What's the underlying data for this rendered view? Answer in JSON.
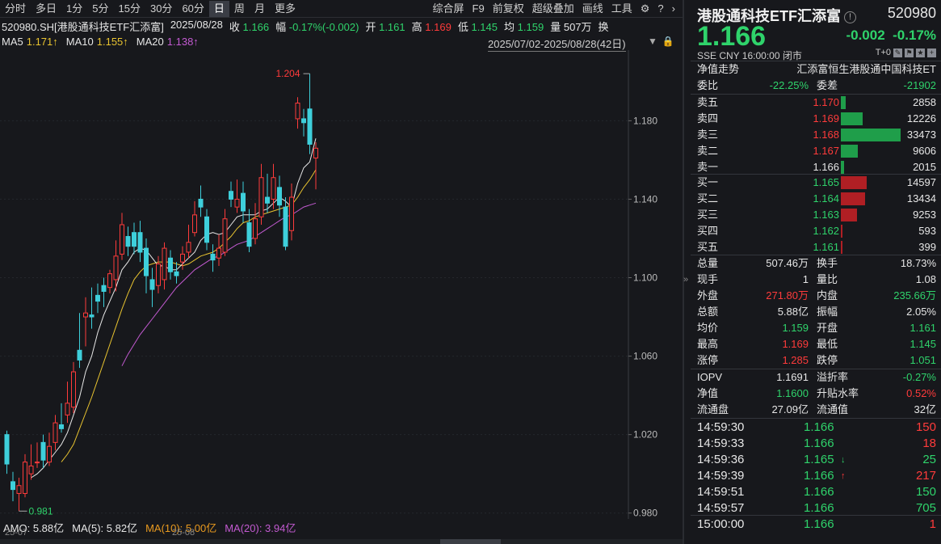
{
  "toolbar": {
    "periods": [
      "分时",
      "多日",
      "1分",
      "5分",
      "15分",
      "30分",
      "60分",
      "日",
      "周",
      "月",
      "更多"
    ],
    "active": "日",
    "right": [
      "综合屏",
      "F9",
      "前复权",
      "超级叠加",
      "画线",
      "工具"
    ]
  },
  "info": {
    "symbol": "520980.SH[港股通科技ETF汇添富]",
    "date": "2025/08/28",
    "close_label": "收",
    "close": "1.166",
    "amp_label": "幅",
    "amp": "-0.17%(-0.002)",
    "open_label": "开",
    "open": "1.161",
    "high_label": "高",
    "high": "1.169",
    "low_label": "低",
    "low": "1.145",
    "avg_label": "均",
    "avg": "1.159",
    "vol_label": "量",
    "vol": "507万",
    "more": "换"
  },
  "ma": {
    "ma5_label": "MA5",
    "ma5": "1.171↑",
    "ma10_label": "MA10",
    "ma10": "1.155↑",
    "ma20_label": "MA20",
    "ma20": "1.138↑",
    "range": "2025/07/02-2025/08/28(42日)"
  },
  "colors": {
    "up": "#ff3b3b",
    "down": "#3ecfdb",
    "ma5": "#e8e8e8",
    "ma10": "#e8c330",
    "ma20": "#c35ad1",
    "bg": "#17181c"
  },
  "chart_data": {
    "type": "candlestick",
    "yticks": [
      "1.180",
      "1.140",
      "1.100",
      "1.060",
      "1.020",
      "0.980"
    ],
    "ylim": [
      0.977,
      1.216
    ],
    "max_label": "1.204",
    "min_label": "0.981",
    "x_labels": [
      "25-07",
      "25-08"
    ],
    "candles": [
      {
        "o": 1.02,
        "c": 1.005,
        "h": 1.022,
        "l": 1.0
      },
      {
        "o": 0.996,
        "c": 0.992,
        "h": 1.001,
        "l": 0.986
      },
      {
        "o": 0.99,
        "c": 0.994,
        "h": 0.998,
        "l": 0.981
      },
      {
        "o": 0.99,
        "c": 1.006,
        "h": 1.01,
        "l": 0.988
      },
      {
        "o": 1.0,
        "c": 1.004,
        "h": 1.015,
        "l": 0.997
      },
      {
        "o": 1.006,
        "c": 1.006,
        "h": 1.016,
        "l": 1.003
      },
      {
        "o": 1.016,
        "c": 1.007,
        "h": 1.02,
        "l": 1.003
      },
      {
        "o": 1.006,
        "c": 1.014,
        "h": 1.021,
        "l": 1.004
      },
      {
        "o": 1.016,
        "c": 1.026,
        "h": 1.03,
        "l": 1.012
      },
      {
        "o": 1.025,
        "c": 1.023,
        "h": 1.036,
        "l": 1.021
      },
      {
        "o": 1.03,
        "c": 1.036,
        "h": 1.047,
        "l": 1.026
      },
      {
        "o": 1.034,
        "c": 1.052,
        "h": 1.057,
        "l": 1.031
      },
      {
        "o": 1.063,
        "c": 1.058,
        "h": 1.082,
        "l": 1.054
      },
      {
        "o": 1.08,
        "c": 1.082,
        "h": 1.09,
        "l": 1.065
      },
      {
        "o": 1.081,
        "c": 1.08,
        "h": 1.095,
        "l": 1.074
      },
      {
        "o": 1.091,
        "c": 1.088,
        "h": 1.097,
        "l": 1.082
      },
      {
        "o": 1.096,
        "c": 1.093,
        "h": 1.1,
        "l": 1.085
      },
      {
        "o": 1.095,
        "c": 1.102,
        "h": 1.104,
        "l": 1.092
      },
      {
        "o": 1.099,
        "c": 1.111,
        "h": 1.119,
        "l": 1.093
      },
      {
        "o": 1.112,
        "c": 1.127,
        "h": 1.133,
        "l": 1.109
      },
      {
        "o": 1.121,
        "c": 1.116,
        "h": 1.126,
        "l": 1.111
      },
      {
        "o": 1.123,
        "c": 1.116,
        "h": 1.128,
        "l": 1.112
      },
      {
        "o": 1.123,
        "c": 1.113,
        "h": 1.129,
        "l": 1.108
      },
      {
        "o": 1.115,
        "c": 1.101,
        "h": 1.12,
        "l": 1.092
      },
      {
        "o": 1.099,
        "c": 1.094,
        "h": 1.105,
        "l": 1.085
      },
      {
        "o": 1.096,
        "c": 1.107,
        "h": 1.111,
        "l": 1.092
      },
      {
        "o": 1.099,
        "c": 1.115,
        "h": 1.118,
        "l": 1.094
      },
      {
        "o": 1.11,
        "c": 1.103,
        "h": 1.114,
        "l": 1.099
      },
      {
        "o": 1.103,
        "c": 1.101,
        "h": 1.108,
        "l": 1.097
      },
      {
        "o": 1.108,
        "c": 1.112,
        "h": 1.116,
        "l": 1.104
      },
      {
        "o": 1.113,
        "c": 1.118,
        "h": 1.127,
        "l": 1.11
      },
      {
        "o": 1.123,
        "c": 1.132,
        "h": 1.139,
        "l": 1.121
      },
      {
        "o": 1.14,
        "c": 1.136,
        "h": 1.147,
        "l": 1.131
      },
      {
        "o": 1.131,
        "c": 1.118,
        "h": 1.135,
        "l": 1.114
      },
      {
        "o": 1.112,
        "c": 1.109,
        "h": 1.117,
        "l": 1.103
      },
      {
        "o": 1.11,
        "c": 1.115,
        "h": 1.122,
        "l": 1.106
      },
      {
        "o": 1.113,
        "c": 1.13,
        "h": 1.135,
        "l": 1.111
      },
      {
        "o": 1.144,
        "c": 1.14,
        "h": 1.149,
        "l": 1.136
      },
      {
        "o": 1.136,
        "c": 1.14,
        "h": 1.15,
        "l": 1.133
      },
      {
        "o": 1.143,
        "c": 1.134,
        "h": 1.149,
        "l": 1.128
      },
      {
        "o": 1.128,
        "c": 1.116,
        "h": 1.135,
        "l": 1.113
      },
      {
        "o": 1.12,
        "c": 1.13,
        "h": 1.138,
        "l": 1.117
      },
      {
        "o": 1.131,
        "c": 1.151,
        "h": 1.158,
        "l": 1.127
      },
      {
        "o": 1.141,
        "c": 1.138,
        "h": 1.153,
        "l": 1.133
      },
      {
        "o": 1.14,
        "c": 1.151,
        "h": 1.158,
        "l": 1.135
      },
      {
        "o": 1.146,
        "c": 1.137,
        "h": 1.152,
        "l": 1.131
      },
      {
        "o": 1.136,
        "c": 1.116,
        "h": 1.141,
        "l": 1.114
      },
      {
        "o": 1.124,
        "c": 1.141,
        "h": 1.148,
        "l": 1.119
      },
      {
        "o": 1.181,
        "c": 1.189,
        "h": 1.192,
        "l": 1.176
      },
      {
        "o": 1.181,
        "c": 1.179,
        "h": 1.186,
        "l": 1.172
      },
      {
        "o": 1.186,
        "c": 1.168,
        "h": 1.204,
        "l": 1.163
      },
      {
        "o": 1.161,
        "c": 1.166,
        "h": 1.169,
        "l": 1.145
      }
    ],
    "ma5": [
      null,
      null,
      null,
      null,
      0.998,
      1.0,
      1.003,
      1.007,
      1.011,
      1.015,
      1.021,
      1.03,
      1.039,
      1.052,
      1.06,
      1.072,
      1.081,
      1.088,
      1.095,
      1.104,
      1.108,
      1.113,
      1.115,
      1.114,
      1.11,
      1.106,
      1.106,
      1.104,
      1.104,
      1.107,
      1.11,
      1.113,
      1.119,
      1.122,
      1.123,
      1.122,
      1.123,
      1.127,
      1.131,
      1.132,
      1.132,
      1.132,
      1.134,
      1.135,
      1.138,
      1.141,
      1.139,
      1.136,
      1.148,
      1.156,
      1.159,
      1.171
    ],
    "ma10": [
      null,
      null,
      null,
      null,
      null,
      null,
      null,
      null,
      null,
      1.006,
      1.01,
      1.015,
      1.023,
      1.031,
      1.039,
      1.048,
      1.057,
      1.066,
      1.075,
      1.084,
      1.092,
      1.099,
      1.103,
      1.106,
      1.107,
      1.108,
      1.108,
      1.108,
      1.107,
      1.106,
      1.107,
      1.109,
      1.111,
      1.112,
      1.113,
      1.115,
      1.118,
      1.121,
      1.125,
      1.128,
      1.129,
      1.131,
      1.132,
      1.133,
      1.134,
      1.135,
      1.136,
      1.137,
      1.141,
      1.146,
      1.15,
      1.155
    ],
    "ma20": [
      null,
      null,
      null,
      null,
      null,
      null,
      null,
      null,
      null,
      null,
      null,
      null,
      null,
      null,
      null,
      null,
      null,
      null,
      null,
      1.055,
      1.061,
      1.066,
      1.071,
      1.075,
      1.079,
      1.083,
      1.087,
      1.091,
      1.095,
      1.098,
      1.101,
      1.104,
      1.106,
      1.108,
      1.11,
      1.111,
      1.113,
      1.115,
      1.117,
      1.118,
      1.119,
      1.121,
      1.123,
      1.125,
      1.127,
      1.129,
      1.131,
      1.132,
      1.134,
      1.136,
      1.137,
      1.138
    ]
  },
  "bottom": {
    "amo": "AMO: 5.88亿",
    "ma5": "MA(5): 5.82亿",
    "ma10": "MA(10): 5.00亿",
    "ma20": "MA(20): 3.94亿",
    "xl1": "25-07",
    "xl2": "25-08"
  },
  "panel": {
    "name": "港股通科技ETF汇添富",
    "code": "520980",
    "price": "1.166",
    "change": "-0.002",
    "pct": "-0.17%",
    "meta": "SSE   CNY   16:00:00  闭市",
    "tplus": "T+0",
    "nav_label": "净值走势",
    "nav_name": "汇添富恒生港股通中国科技ET",
    "wb_label": "委比",
    "wb": "-22.25%",
    "wc_label": "委差",
    "wc": "-21902",
    "asks": [
      {
        "label": "卖五",
        "price": "1.170",
        "vol": "2858",
        "w": 0.085
      },
      {
        "label": "卖四",
        "price": "1.169",
        "vol": "12226",
        "w": 0.365
      },
      {
        "label": "卖三",
        "price": "1.168",
        "vol": "33473",
        "w": 1.0
      },
      {
        "label": "卖二",
        "price": "1.167",
        "vol": "9606",
        "w": 0.287
      },
      {
        "label": "卖一",
        "price": "1.166",
        "vol": "2015",
        "w": 0.06
      }
    ],
    "bids": [
      {
        "label": "买一",
        "price": "1.165",
        "vol": "14597",
        "w": 0.436
      },
      {
        "label": "买二",
        "price": "1.164",
        "vol": "13434",
        "w": 0.401
      },
      {
        "label": "买三",
        "price": "1.163",
        "vol": "9253",
        "w": 0.276
      },
      {
        "label": "买四",
        "price": "1.162",
        "vol": "593",
        "w": 0.018
      },
      {
        "label": "买五",
        "price": "1.161",
        "vol": "399",
        "w": 0.012
      }
    ],
    "stats": [
      {
        "k1": "总量",
        "v1": "507.46万",
        "k2": "换手",
        "v2": "18.73%",
        "c1": "white",
        "c2": "white"
      },
      {
        "k1": "现手",
        "v1": "1",
        "k2": "量比",
        "v2": "1.08",
        "c1": "white",
        "c2": "white"
      },
      {
        "k1": "外盘",
        "v1": "271.80万",
        "k2": "内盘",
        "v2": "235.66万",
        "c1": "red",
        "c2": "green"
      },
      {
        "k1": "总额",
        "v1": "5.88亿",
        "k2": "振幅",
        "v2": "2.05%",
        "c1": "white",
        "c2": "white"
      },
      {
        "k1": "均价",
        "v1": "1.159",
        "k2": "开盘",
        "v2": "1.161",
        "c1": "green",
        "c2": "green"
      },
      {
        "k1": "最高",
        "v1": "1.169",
        "k2": "最低",
        "v2": "1.145",
        "c1": "red",
        "c2": "green"
      },
      {
        "k1": "涨停",
        "v1": "1.285",
        "k2": "跌停",
        "v2": "1.051",
        "c1": "red",
        "c2": "green"
      }
    ],
    "stats2": [
      {
        "k1": "IOPV",
        "v1": "1.1691",
        "k2": "溢折率",
        "v2": "-0.27%",
        "c1": "white",
        "c2": "green"
      },
      {
        "k1": "净值",
        "v1": "1.1600",
        "k2": "升贴水率",
        "v2": "0.52%",
        "c1": "green",
        "c2": "red"
      },
      {
        "k1": "流通盘",
        "v1": "27.09亿",
        "k2": "流通值",
        "v2": "32亿",
        "c1": "white",
        "c2": "white"
      }
    ],
    "ticks": [
      {
        "t": "14:59:30",
        "p": "1.166",
        "arr": "",
        "v": "150",
        "c": "red"
      },
      {
        "t": "14:59:33",
        "p": "1.166",
        "arr": "",
        "v": "18",
        "c": "red"
      },
      {
        "t": "14:59:36",
        "p": "1.165",
        "arr": "↓",
        "v": "25",
        "c": "green"
      },
      {
        "t": "14:59:39",
        "p": "1.166",
        "arr": "↑",
        "v": "217",
        "c": "red"
      },
      {
        "t": "14:59:51",
        "p": "1.166",
        "arr": "",
        "v": "150",
        "c": "green"
      },
      {
        "t": "14:59:57",
        "p": "1.166",
        "arr": "",
        "v": "705",
        "c": "green"
      },
      {
        "t": "15:00:00",
        "p": "1.166",
        "arr": "",
        "v": "1",
        "c": "red"
      }
    ]
  }
}
